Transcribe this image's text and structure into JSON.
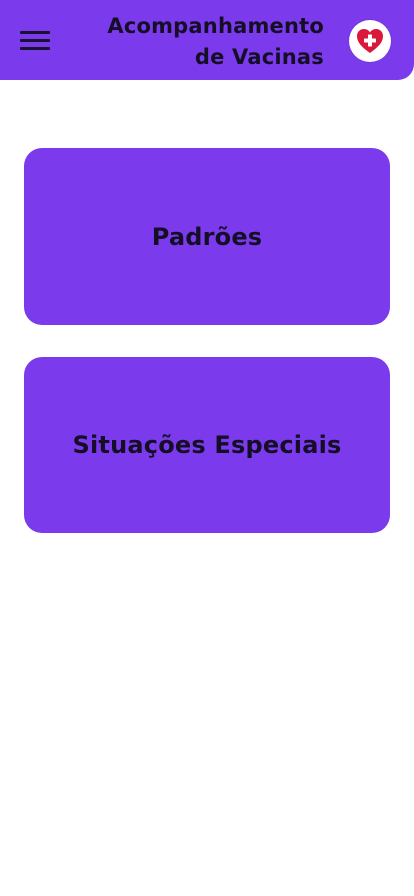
{
  "header": {
    "title_line1": "Acompanhamento",
    "title_line2": "de Vacinas",
    "menu_icon": "hamburger-menu-icon",
    "logo_icon": "heart-medical-cross-icon"
  },
  "main": {
    "cards": [
      {
        "label": "Padrões"
      },
      {
        "label": "Situações Especiais"
      }
    ]
  },
  "colors": {
    "primary": "#7c3aed",
    "text_dark": "#140f26",
    "background": "#ffffff",
    "logo_heart": "#d9183b"
  }
}
